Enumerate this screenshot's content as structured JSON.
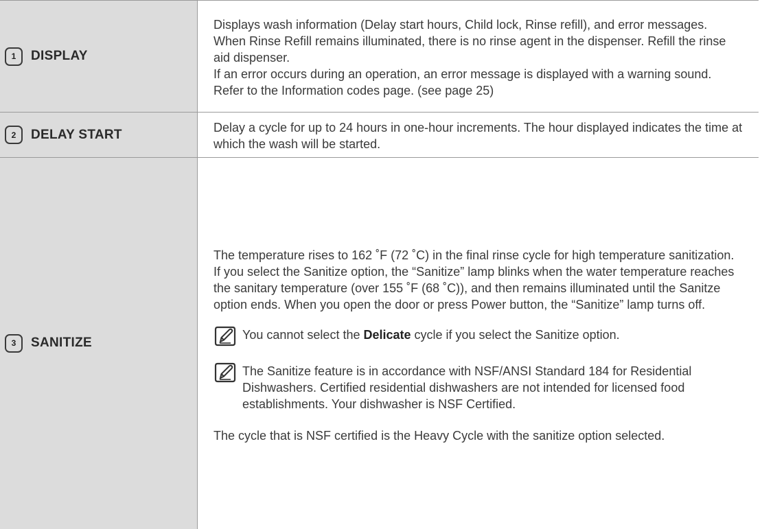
{
  "rows": [
    {
      "number": "1",
      "label": "DISPLAY",
      "paragraphs": [
        "Displays wash information (Delay start hours, Child lock, Rinse refill), and error messages.",
        "When Rinse Refill remains illuminated, there is no rinse agent in the dispenser. Refill the rinse aid dispenser.",
        "If an error occurs during an operation, an error message is displayed with a warning sound. Refer to the Information codes page. (see page 25)"
      ]
    },
    {
      "number": "2",
      "label": "DELAY START",
      "paragraphs": [
        "Delay a cycle for up to 24 hours in one-hour increments. The hour displayed indicates the time at which the wash will be started."
      ]
    },
    {
      "number": "3",
      "label": "SANITIZE",
      "paragraphs": [
        "The temperature rises to 162 ˚F (72 ˚C) in the final rinse cycle for high temperature sanitization.",
        "If you select the Sanitize option, the “Sanitize” lamp blinks when the water temperature reaches the sanitary temperature (over 155 ˚F (68 ˚C)), and then remains illuminated until the Sanitze option ends. When you open the door or press Power button, the “Sanitize” lamp turns off."
      ],
      "note1": {
        "before": "You cannot select the ",
        "bold": "Delicate",
        "after": " cycle if you select the Sanitize option."
      },
      "note2": "The Sanitize feature is in accordance with NSF/ANSI Standard 184 for Residential Dishwashers. Certified residential dishwashers are not intended for licensed food establishments. Your dishwasher is NSF Certified.",
      "closing": "The cycle that is NSF certified is the Heavy Cycle with the sanitize option selected."
    }
  ],
  "icons": {
    "note": "note-pencil-icon"
  },
  "colors": {
    "label_background": "#dcdcdc",
    "border": "#9a9a9a",
    "text": "#3a3a3a"
  }
}
